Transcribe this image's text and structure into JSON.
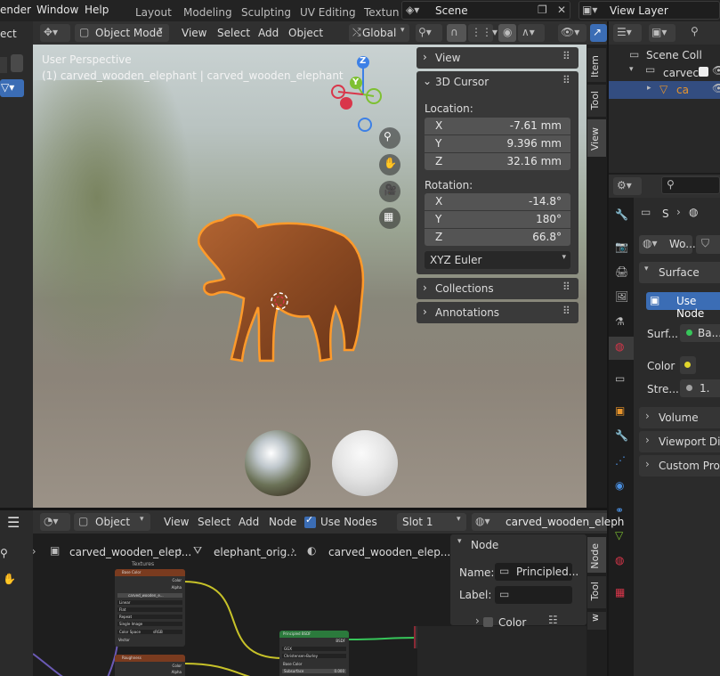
{
  "topbar": {
    "menus": [
      "ender",
      "Window",
      "Help"
    ],
    "workspaces": [
      "Layout",
      "Modeling",
      "Sculpting",
      "UV Editing",
      "Textun"
    ],
    "scene": "Scene",
    "view_layer": "View Layer"
  },
  "viewport_header": {
    "left_label": "ect",
    "mode": "Object Mode",
    "menus": [
      "View",
      "Select",
      "Add",
      "Object"
    ],
    "transform": "Global"
  },
  "viewport": {
    "perspective": "User Perspective",
    "object_info": "(1) carved_wooden_elephant | carved_wooden_elephant",
    "gizmo": {
      "z": "Z",
      "y": "Y"
    }
  },
  "npanel": {
    "view": "View",
    "cursor": "3D Cursor",
    "location_label": "Location:",
    "location": [
      {
        "axis": "X",
        "value": "-7.61 mm"
      },
      {
        "axis": "Y",
        "value": "9.396 mm"
      },
      {
        "axis": "Z",
        "value": "32.16 mm"
      }
    ],
    "rotation_label": "Rotation:",
    "rotation": [
      {
        "axis": "X",
        "value": "-14.8°"
      },
      {
        "axis": "Y",
        "value": "180°"
      },
      {
        "axis": "Z",
        "value": "66.8°"
      }
    ],
    "rot_mode": "XYZ Euler",
    "collections": "Collections",
    "annotations": "Annotations",
    "tabs": [
      "Item",
      "Tool",
      "View"
    ]
  },
  "outliner": {
    "scene_coll": "Scene Coll",
    "item1": "carvec",
    "item2": "ca"
  },
  "properties": {
    "crumb": "S",
    "material_name": "Wo...",
    "surface": "Surface",
    "use_nodes": "Use Node",
    "surf_label": "Surf...",
    "surf_value": "Ba...",
    "color_label": "Color",
    "strength_label": "Stre...",
    "strength_value": "1.",
    "volume": "Volume",
    "viewport_display": "Viewport Disp",
    "custom_props": "Custom Prope"
  },
  "node_header": {
    "editor": "Object",
    "menus": [
      "View",
      "Select",
      "Add",
      "Node"
    ],
    "use_nodes": "Use Nodes",
    "slot": "Slot 1",
    "material": "carved_wooden_eleph"
  },
  "node_breadcrumb": [
    "carved_wooden_elep...",
    "elephant_orig...",
    "carved_wooden_elep..."
  ],
  "node_panel": {
    "title": "Node",
    "name_label": "Name:",
    "name_value": "Principled...",
    "label_label": "Label:",
    "color": "Color",
    "tabs": [
      "Node",
      "Tool",
      "w"
    ]
  },
  "node_canvas": {
    "frame_label": "Textures",
    "node1_title": "Base Color",
    "node2_title": "Roughness",
    "bsdf_title": "Principled BSDF",
    "node1_field": "carved_wooden_e...",
    "node1_rows": [
      "Linear",
      "Flat",
      "Repeat",
      "Single Image"
    ],
    "node1_colorspace": "Color Space",
    "node1_cs_val": "sRGB",
    "node1_vector": "Vector",
    "out_color": "Color",
    "out_alpha": "Alpha",
    "bsdf_out": "BSDF",
    "bsdf_rows": [
      "GGX",
      "Christensen-Burley",
      "Base Color",
      "Subsurface"
    ],
    "bsdf_sub_val": "0.000"
  }
}
